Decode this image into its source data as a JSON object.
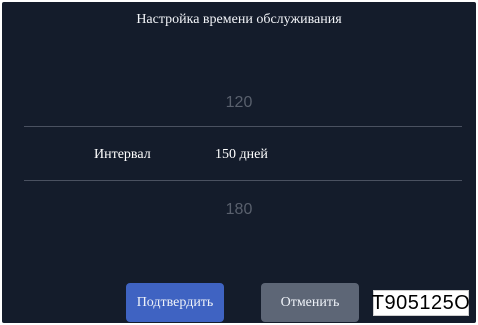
{
  "header": {
    "title": "Настройка времени обслуживания"
  },
  "picker": {
    "above": "120",
    "label": "Интервал",
    "selected": "150 дней",
    "below": "180"
  },
  "buttons": {
    "confirm": "Подтвердить",
    "cancel": "Отменить"
  },
  "figure_code": "T905125O",
  "colors": {
    "background": "#141c2b",
    "confirm_button": "#3f63c2",
    "cancel_button": "#5d6676",
    "divider": "#4a5160",
    "inactive_text": "#59606d"
  }
}
